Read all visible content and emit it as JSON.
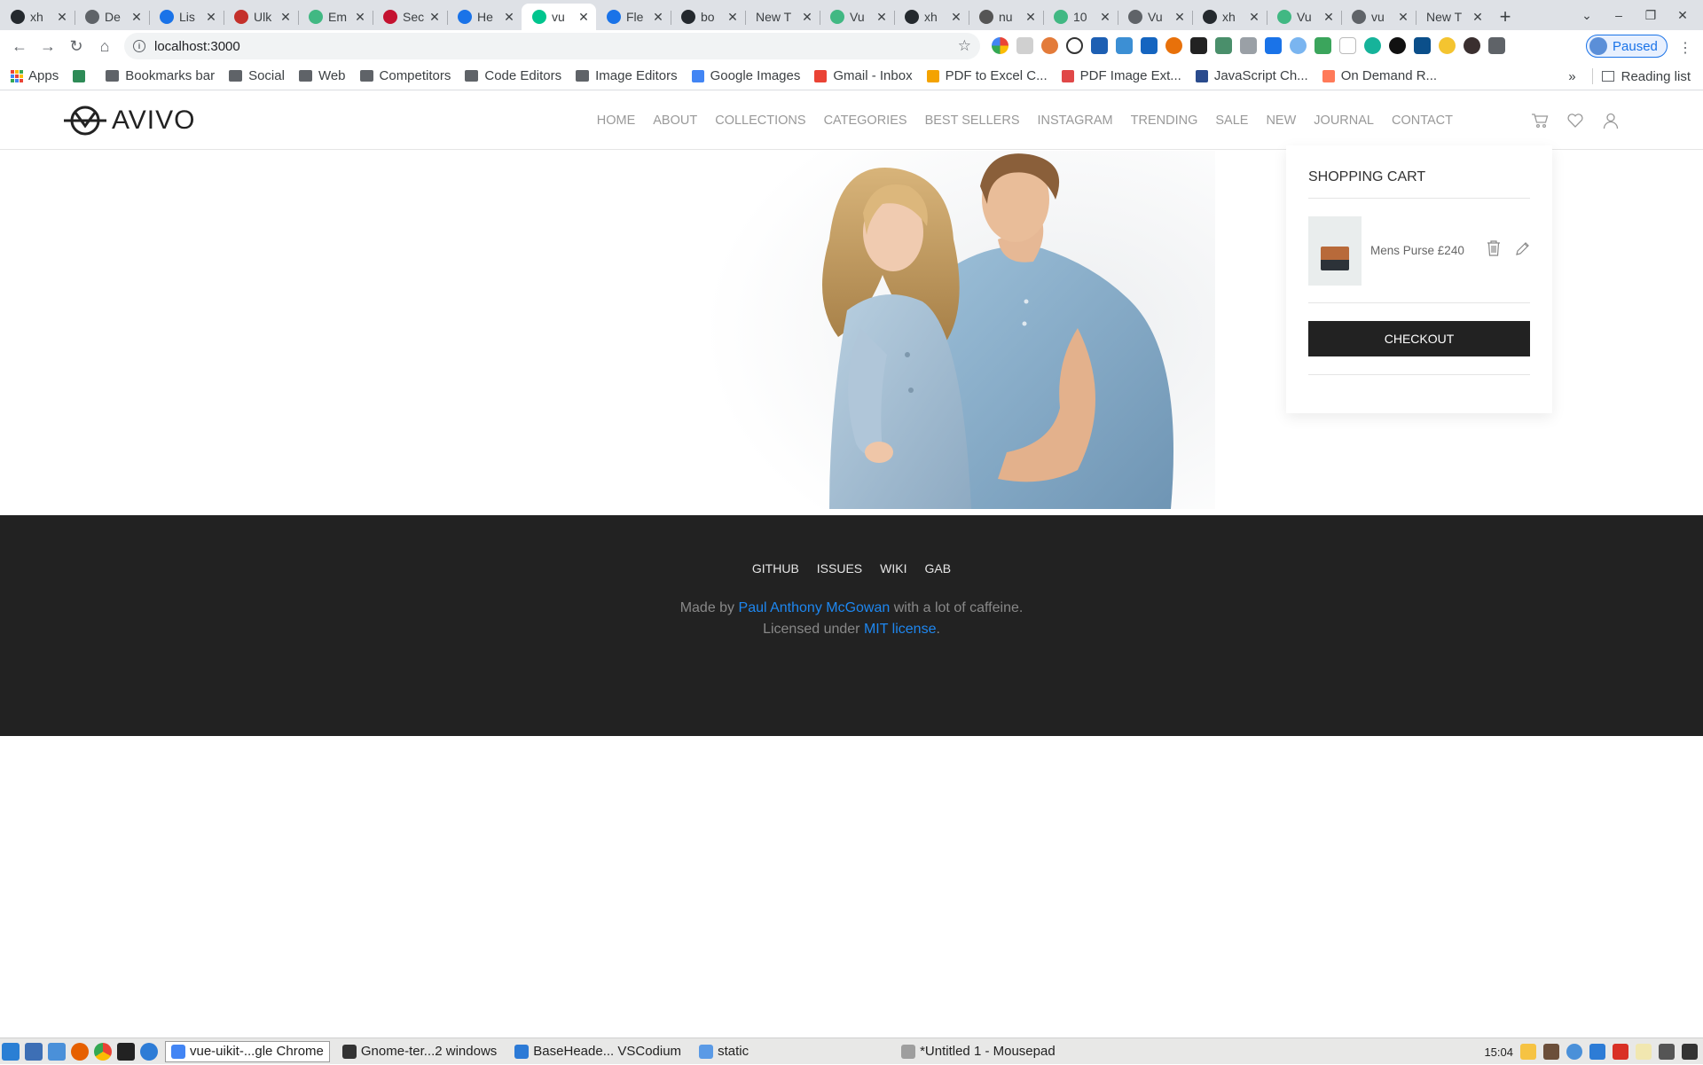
{
  "browser": {
    "tabs": [
      {
        "title": "xh",
        "icon": "github-icon",
        "color": "#24292e"
      },
      {
        "title": "De",
        "icon": "globe-icon",
        "color": "#5f6368"
      },
      {
        "title": "Lis",
        "icon": "loading-icon",
        "color": "#1a73e8"
      },
      {
        "title": "Ulk",
        "icon": "tp-icon",
        "color": "#c4302b"
      },
      {
        "title": "Em",
        "icon": "vue-icon",
        "color": "#41b883"
      },
      {
        "title": "Sec",
        "icon": "flask-icon",
        "color": "#c41230"
      },
      {
        "title": "He",
        "icon": "loading-icon",
        "color": "#1a73e8"
      },
      {
        "title": "vu",
        "icon": "nuxt-icon",
        "color": "#00c58e",
        "active": true
      },
      {
        "title": "Fle",
        "icon": "loading-icon",
        "color": "#1a73e8"
      },
      {
        "title": "bo",
        "icon": "github-icon",
        "color": "#24292e"
      },
      {
        "title": "New T",
        "icon": "",
        "color": ""
      },
      {
        "title": "Vu",
        "icon": "vue-icon",
        "color": "#41b883"
      },
      {
        "title": "xh",
        "icon": "github-icon",
        "color": "#24292e"
      },
      {
        "title": "nu",
        "icon": "nuxt-icon",
        "color": "#555555"
      },
      {
        "title": "10",
        "icon": "vue-icon",
        "color": "#41b883"
      },
      {
        "title": "Vu",
        "icon": "globe-icon",
        "color": "#5f6368"
      },
      {
        "title": "xh",
        "icon": "github-icon",
        "color": "#24292e"
      },
      {
        "title": "Vu",
        "icon": "vue-icon",
        "color": "#41b883"
      },
      {
        "title": "vu",
        "icon": "globe-icon",
        "color": "#5f6368"
      },
      {
        "title": "New T",
        "icon": "",
        "color": ""
      }
    ],
    "new_tab": "+",
    "url": "localhost:3000",
    "paused_label": "Paused",
    "bookmarks": [
      {
        "label": "Apps",
        "type": "apps"
      },
      {
        "label": "",
        "type": "w"
      },
      {
        "label": "Bookmarks bar",
        "type": "folder"
      },
      {
        "label": "Social",
        "type": "folder"
      },
      {
        "label": "Web",
        "type": "folder"
      },
      {
        "label": "Competitors",
        "type": "folder"
      },
      {
        "label": "Code Editors",
        "type": "folder"
      },
      {
        "label": "Image Editors",
        "type": "folder"
      },
      {
        "label": "Google Images",
        "type": "google"
      },
      {
        "label": "Gmail - Inbox",
        "type": "gmail"
      },
      {
        "label": "PDF to Excel C...",
        "type": "pdf"
      },
      {
        "label": "PDF Image Ext...",
        "type": "pdfimg"
      },
      {
        "label": "JavaScript Ch...",
        "type": "js"
      },
      {
        "label": "On Demand R...",
        "type": "hubspot"
      }
    ],
    "bookmarks_more": "»",
    "reading_list": "Reading list"
  },
  "site": {
    "logo_text": "AVIVO",
    "nav": [
      "HOME",
      "ABOUT",
      "COLLECTIONS",
      "CATEGORIES",
      "BEST SELLERS",
      "INSTAGRAM",
      "TRENDING",
      "SALE",
      "NEW",
      "JOURNAL",
      "CONTACT"
    ],
    "cart": {
      "title": "SHOPPING CART",
      "items": [
        {
          "name": "Mens Purse",
          "price": "£240"
        }
      ],
      "checkout_label": "CHECKOUT"
    },
    "footer": {
      "links": [
        "GITHUB",
        "ISSUES",
        "WIKI",
        "GAB"
      ],
      "made_by_prefix": "Made by",
      "author": "Paul Anthony McGowan",
      "made_by_suffix": "with a lot of caffeine.",
      "license_prefix": "Licensed under",
      "license_link": "MIT license",
      "license_suffix": "."
    },
    "colors": {
      "footer_bg": "#222222",
      "link": "#1e87f0",
      "checkout_bg": "#222222"
    }
  },
  "taskbar": {
    "windows": [
      {
        "label": "vue-uikit-...gle Chrome",
        "active": true
      },
      {
        "label": "Gnome-ter...2 windows",
        "active": false
      },
      {
        "label": "BaseHeade... VSCodium",
        "active": false
      },
      {
        "label": "static",
        "active": false
      },
      {
        "label": "*Untitled 1 - Mousepad",
        "active": false
      }
    ],
    "clock": "15:04"
  }
}
